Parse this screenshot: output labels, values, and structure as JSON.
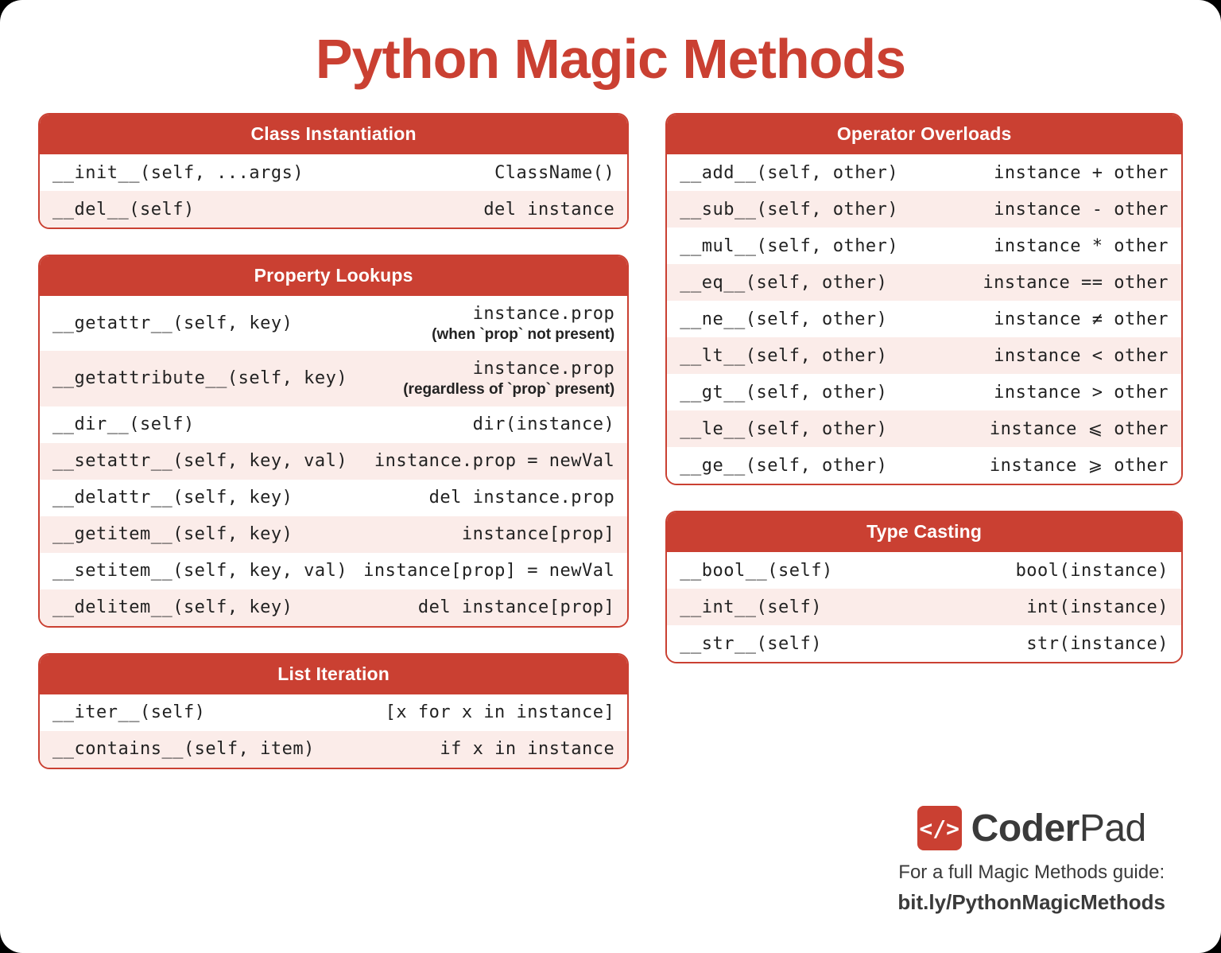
{
  "title": "Python Magic Methods",
  "sections": {
    "class_instantiation": {
      "heading": "Class Instantiation",
      "rows": [
        {
          "left": "__init__(self, ...args)",
          "right": "ClassName()"
        },
        {
          "left": "__del__(self)",
          "right": "del instance"
        }
      ]
    },
    "property_lookups": {
      "heading": "Property Lookups",
      "rows": [
        {
          "left": "__getattr__(self, key)",
          "right": "instance.prop",
          "note": "(when `prop` not present)"
        },
        {
          "left": "__getattribute__(self, key)",
          "right": "instance.prop",
          "note": "(regardless of `prop` present)"
        },
        {
          "left": "__dir__(self)",
          "right": "dir(instance)"
        },
        {
          "left": "__setattr__(self, key, val)",
          "right": "instance.prop = newVal"
        },
        {
          "left": "__delattr__(self, key)",
          "right": "del instance.prop"
        },
        {
          "left": "__getitem__(self, key)",
          "right": "instance[prop]"
        },
        {
          "left": "__setitem__(self, key, val)",
          "right": "instance[prop] = newVal"
        },
        {
          "left": "__delitem__(self, key)",
          "right": "del instance[prop]"
        }
      ]
    },
    "list_iteration": {
      "heading": "List Iteration",
      "rows": [
        {
          "left": "__iter__(self)",
          "right": "[x for x in instance]"
        },
        {
          "left": "__contains__(self, item)",
          "right": "if x in instance"
        }
      ]
    },
    "operator_overloads": {
      "heading": "Operator Overloads",
      "rows": [
        {
          "left": "__add__(self, other)",
          "right": "instance + other"
        },
        {
          "left": "__sub__(self, other)",
          "right": "instance - other"
        },
        {
          "left": "__mul__(self, other)",
          "right": "instance * other"
        },
        {
          "left": "__eq__(self, other)",
          "right": "instance == other"
        },
        {
          "left": "__ne__(self, other)",
          "right": "instance ≠ other"
        },
        {
          "left": "__lt__(self, other)",
          "right": "instance < other"
        },
        {
          "left": "__gt__(self, other)",
          "right": "instance > other"
        },
        {
          "left": "__le__(self, other)",
          "right": "instance ⩽ other"
        },
        {
          "left": "__ge__(self, other)",
          "right": "instance ⩾ other"
        }
      ]
    },
    "type_casting": {
      "heading": "Type Casting",
      "rows": [
        {
          "left": "__bool__(self)",
          "right": "bool(instance)"
        },
        {
          "left": "__int__(self)",
          "right": "int(instance)"
        },
        {
          "left": "__str__(self)",
          "right": "str(instance)"
        }
      ]
    }
  },
  "footer": {
    "logo_mark": "</>",
    "logo_bold": "Coder",
    "logo_light": "Pad",
    "line1": "For a full Magic Methods guide:",
    "link": "bit.ly/PythonMagicMethods"
  }
}
